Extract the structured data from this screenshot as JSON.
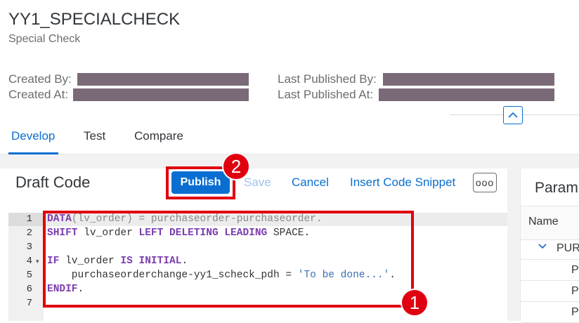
{
  "header": {
    "title": "YY1_SPECIALCHECK",
    "subtitle": "Special Check",
    "created_by_label": "Created By:",
    "created_at_label": "Created At:",
    "last_published_by_label": "Last Published By:",
    "last_published_at_label": "Last Published At:"
  },
  "tabs": [
    {
      "label": "Develop",
      "active": true
    },
    {
      "label": "Test"
    },
    {
      "label": "Compare"
    }
  ],
  "editor": {
    "title": "Draft Code",
    "publish_label": "Publish",
    "save_label": "Save",
    "cancel_label": "Cancel",
    "insert_snippet_label": "Insert Code Snippet",
    "more_label": "ooo",
    "line_numbers": [
      "1",
      "2",
      "3",
      "4",
      "5",
      "6",
      "7"
    ],
    "lines": {
      "l1a": "DATA",
      "l1b": "(lv_order) = purchaseorder-purchaseorder.",
      "l2a": "SHIFT",
      "l2b": " lv_order ",
      "l2c": "LEFT DELETING LEADING",
      "l2d": " SPACE.",
      "l4a": "IF",
      "l4b": " lv_order ",
      "l4c": "IS INITIAL",
      "l4d": ".",
      "l5a": "    purchaseorderchange-yy1_scheck_pdh = ",
      "l5b": "'To be done...'",
      "l5c": ".",
      "l6a": "ENDIF",
      "l6b": "."
    }
  },
  "annotations": {
    "badge1": "1",
    "badge2": "2",
    "accent": "#e0000f"
  },
  "right_panel": {
    "title": "Param",
    "column_name": "Name",
    "group_row": "PUR",
    "rows": [
      "P",
      "P",
      "P"
    ]
  },
  "colors": {
    "primary": "#0a6ed1",
    "keyword": "#7a3cae",
    "string": "#3a6fb5"
  }
}
